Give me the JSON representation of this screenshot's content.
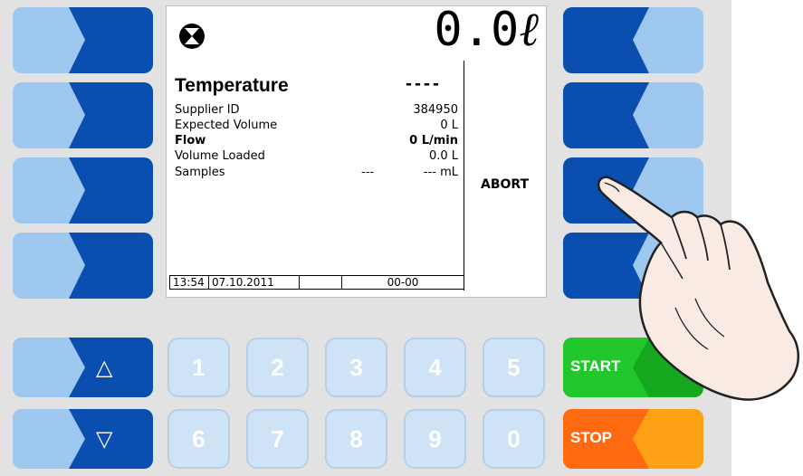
{
  "display": {
    "volume": "0.0",
    "volume_unit": "ℓ",
    "title": "Temperature",
    "title_value": "----",
    "rows": [
      {
        "label": "Supplier ID",
        "mid": "",
        "value": "384950",
        "bold": false
      },
      {
        "label": "Expected Volume",
        "mid": "",
        "value": "0 L",
        "bold": false
      },
      {
        "label": "Flow",
        "mid": "",
        "value": "0 L/min",
        "bold": true
      },
      {
        "label": "Volume Loaded",
        "mid": "",
        "value": "0.0 L",
        "bold": false
      },
      {
        "label": "Samples",
        "mid": "---",
        "value": "--- mL",
        "bold": false
      }
    ],
    "softkey_label": "ABORT",
    "status": {
      "time": "13:54",
      "date": "07.10.2011",
      "code": "00-00"
    }
  },
  "keys": {
    "up": "△",
    "down": "▽",
    "numbers_row1": [
      "1",
      "2",
      "3",
      "4",
      "5"
    ],
    "numbers_row2": [
      "6",
      "7",
      "8",
      "9",
      "0"
    ],
    "start": "START",
    "stop": "STOP"
  },
  "colors": {
    "key_dark": "#0a4fb0",
    "key_light": "#9fc8f0",
    "start": "#22c72b",
    "stop": "#ff6a10"
  }
}
